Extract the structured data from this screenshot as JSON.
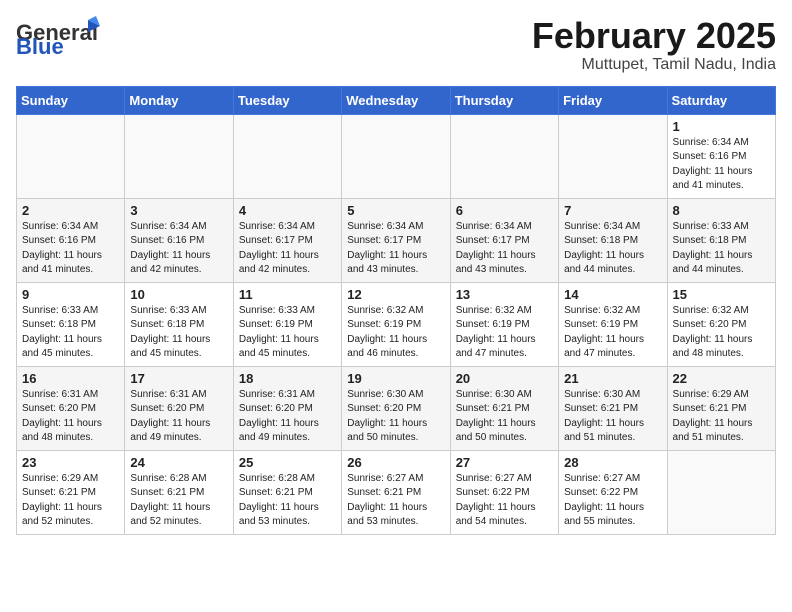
{
  "header": {
    "logo_general": "General",
    "logo_blue": "Blue",
    "month_title": "February 2025",
    "location": "Muttupet, Tamil Nadu, India"
  },
  "weekdays": [
    "Sunday",
    "Monday",
    "Tuesday",
    "Wednesday",
    "Thursday",
    "Friday",
    "Saturday"
  ],
  "weeks": [
    [
      {
        "day": "",
        "info": ""
      },
      {
        "day": "",
        "info": ""
      },
      {
        "day": "",
        "info": ""
      },
      {
        "day": "",
        "info": ""
      },
      {
        "day": "",
        "info": ""
      },
      {
        "day": "",
        "info": ""
      },
      {
        "day": "1",
        "info": "Sunrise: 6:34 AM\nSunset: 6:16 PM\nDaylight: 11 hours\nand 41 minutes."
      }
    ],
    [
      {
        "day": "2",
        "info": "Sunrise: 6:34 AM\nSunset: 6:16 PM\nDaylight: 11 hours\nand 41 minutes."
      },
      {
        "day": "3",
        "info": "Sunrise: 6:34 AM\nSunset: 6:16 PM\nDaylight: 11 hours\nand 42 minutes."
      },
      {
        "day": "4",
        "info": "Sunrise: 6:34 AM\nSunset: 6:17 PM\nDaylight: 11 hours\nand 42 minutes."
      },
      {
        "day": "5",
        "info": "Sunrise: 6:34 AM\nSunset: 6:17 PM\nDaylight: 11 hours\nand 43 minutes."
      },
      {
        "day": "6",
        "info": "Sunrise: 6:34 AM\nSunset: 6:17 PM\nDaylight: 11 hours\nand 43 minutes."
      },
      {
        "day": "7",
        "info": "Sunrise: 6:34 AM\nSunset: 6:18 PM\nDaylight: 11 hours\nand 44 minutes."
      },
      {
        "day": "8",
        "info": "Sunrise: 6:33 AM\nSunset: 6:18 PM\nDaylight: 11 hours\nand 44 minutes."
      }
    ],
    [
      {
        "day": "9",
        "info": "Sunrise: 6:33 AM\nSunset: 6:18 PM\nDaylight: 11 hours\nand 45 minutes."
      },
      {
        "day": "10",
        "info": "Sunrise: 6:33 AM\nSunset: 6:18 PM\nDaylight: 11 hours\nand 45 minutes."
      },
      {
        "day": "11",
        "info": "Sunrise: 6:33 AM\nSunset: 6:19 PM\nDaylight: 11 hours\nand 45 minutes."
      },
      {
        "day": "12",
        "info": "Sunrise: 6:32 AM\nSunset: 6:19 PM\nDaylight: 11 hours\nand 46 minutes."
      },
      {
        "day": "13",
        "info": "Sunrise: 6:32 AM\nSunset: 6:19 PM\nDaylight: 11 hours\nand 47 minutes."
      },
      {
        "day": "14",
        "info": "Sunrise: 6:32 AM\nSunset: 6:19 PM\nDaylight: 11 hours\nand 47 minutes."
      },
      {
        "day": "15",
        "info": "Sunrise: 6:32 AM\nSunset: 6:20 PM\nDaylight: 11 hours\nand 48 minutes."
      }
    ],
    [
      {
        "day": "16",
        "info": "Sunrise: 6:31 AM\nSunset: 6:20 PM\nDaylight: 11 hours\nand 48 minutes."
      },
      {
        "day": "17",
        "info": "Sunrise: 6:31 AM\nSunset: 6:20 PM\nDaylight: 11 hours\nand 49 minutes."
      },
      {
        "day": "18",
        "info": "Sunrise: 6:31 AM\nSunset: 6:20 PM\nDaylight: 11 hours\nand 49 minutes."
      },
      {
        "day": "19",
        "info": "Sunrise: 6:30 AM\nSunset: 6:20 PM\nDaylight: 11 hours\nand 50 minutes."
      },
      {
        "day": "20",
        "info": "Sunrise: 6:30 AM\nSunset: 6:21 PM\nDaylight: 11 hours\nand 50 minutes."
      },
      {
        "day": "21",
        "info": "Sunrise: 6:30 AM\nSunset: 6:21 PM\nDaylight: 11 hours\nand 51 minutes."
      },
      {
        "day": "22",
        "info": "Sunrise: 6:29 AM\nSunset: 6:21 PM\nDaylight: 11 hours\nand 51 minutes."
      }
    ],
    [
      {
        "day": "23",
        "info": "Sunrise: 6:29 AM\nSunset: 6:21 PM\nDaylight: 11 hours\nand 52 minutes."
      },
      {
        "day": "24",
        "info": "Sunrise: 6:28 AM\nSunset: 6:21 PM\nDaylight: 11 hours\nand 52 minutes."
      },
      {
        "day": "25",
        "info": "Sunrise: 6:28 AM\nSunset: 6:21 PM\nDaylight: 11 hours\nand 53 minutes."
      },
      {
        "day": "26",
        "info": "Sunrise: 6:27 AM\nSunset: 6:21 PM\nDaylight: 11 hours\nand 53 minutes."
      },
      {
        "day": "27",
        "info": "Sunrise: 6:27 AM\nSunset: 6:22 PM\nDaylight: 11 hours\nand 54 minutes."
      },
      {
        "day": "28",
        "info": "Sunrise: 6:27 AM\nSunset: 6:22 PM\nDaylight: 11 hours\nand 55 minutes."
      },
      {
        "day": "",
        "info": ""
      }
    ]
  ]
}
